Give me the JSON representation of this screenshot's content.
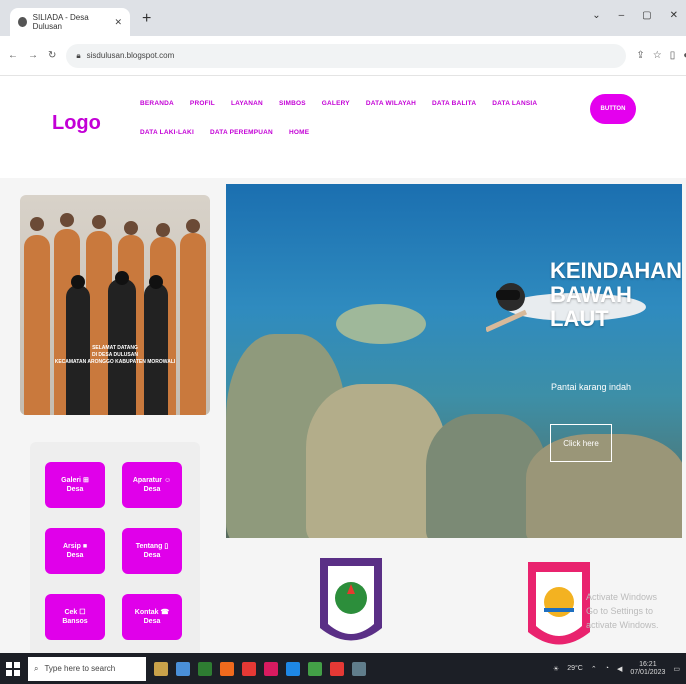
{
  "browser": {
    "tab_title": "SILIADA - Desa Dulusan",
    "new_tab": "+",
    "url": "sisdulusan.blogspot.com",
    "window_controls": [
      "⌄",
      "–",
      "▢",
      "✕"
    ]
  },
  "site": {
    "logo": "Logo",
    "nav": [
      "BERANDA",
      "PROFIL",
      "LAYANAN",
      "SIMBOS",
      "GALERY",
      "DATA WILAYAH",
      "DATA BALITA",
      "DATA LANSIA",
      "DATA LAKI-LAKI",
      "DATA PEREMPUAN",
      "HOME"
    ],
    "header_button": "BUTTON"
  },
  "team_photo": {
    "caption": [
      "SELAMAT DATANG",
      "DI DESA DULUSAN",
      "KECAMATAN ARONGGO KABUPATEN MOROWALI"
    ]
  },
  "quicklinks": [
    {
      "label": "Galeri",
      "sub": "Desa",
      "icon": "image-icon",
      "glyph": "⊞"
    },
    {
      "label": "Aparatur",
      "sub": "Desa",
      "icon": "people-icon",
      "glyph": "☺"
    },
    {
      "label": "Arsip",
      "sub": "Desa",
      "icon": "folder-icon",
      "glyph": "■"
    },
    {
      "label": "Tentang",
      "sub": "Desa",
      "icon": "info-icon",
      "glyph": "▯"
    },
    {
      "label": "Cek",
      "sub": "Bansos",
      "icon": "card-icon",
      "glyph": "☐"
    },
    {
      "label": "Kontak",
      "sub": "Desa",
      "icon": "contact-icon",
      "glyph": "☎"
    }
  ],
  "hero": {
    "title_lines": [
      "KEINDAHAN",
      "BAWAH",
      "LAUT"
    ],
    "subtitle": "Pantai karang indah",
    "button": "Click here"
  },
  "activate_windows": {
    "line1": "Activate Windows",
    "line2": "Go to Settings to activate Windows."
  },
  "taskbar": {
    "search_placeholder": "Type here to search",
    "weather": "29°C",
    "time": "16:21",
    "date": "07/01/2023"
  }
}
